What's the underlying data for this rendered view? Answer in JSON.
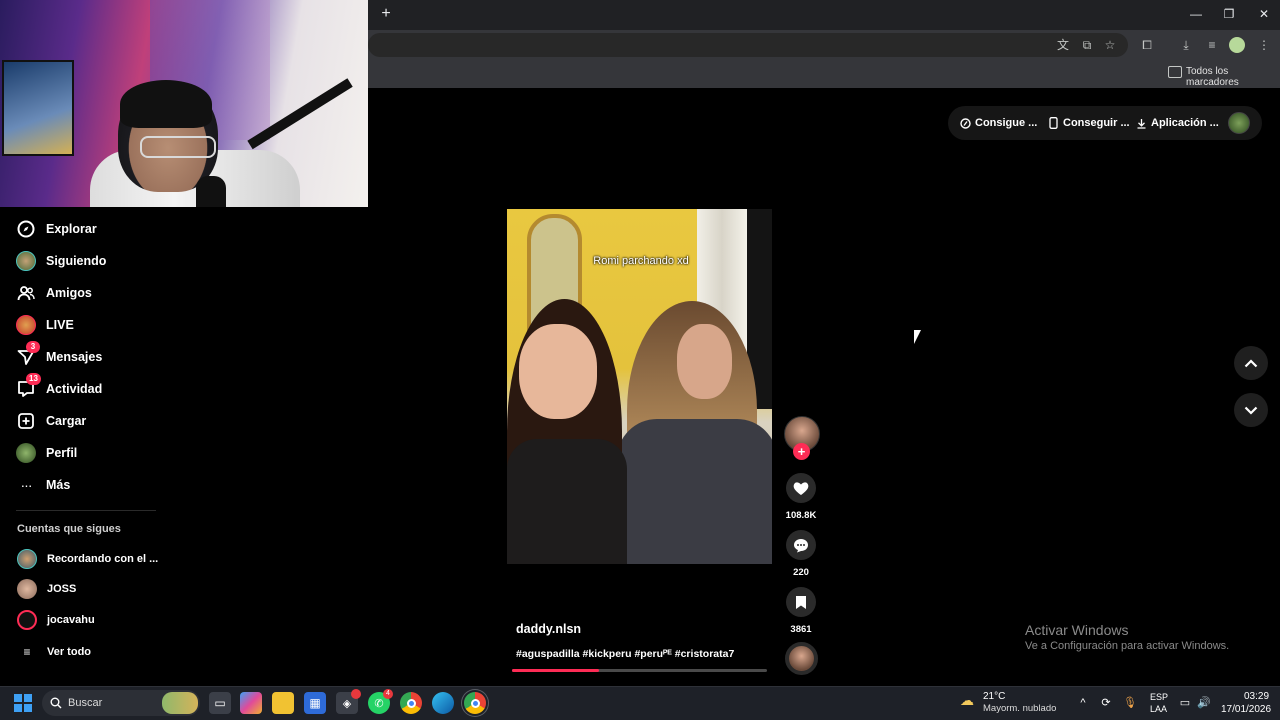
{
  "browser": {
    "new_tab_icon": "plus-icon",
    "window_controls": [
      "minimize",
      "restore",
      "close"
    ],
    "bookmarks_bar_label": "Todos los marcadores"
  },
  "header": {
    "buttons": [
      {
        "label": "Consigue ...",
        "icon": "coin-icon"
      },
      {
        "label": "Conseguir ...",
        "icon": "phone-icon"
      },
      {
        "label": "Aplicación ...",
        "icon": "download-icon"
      }
    ]
  },
  "sidebar": {
    "items": [
      {
        "label": "Explorar",
        "icon": "compass-icon"
      },
      {
        "label": "Siguiendo",
        "icon": "avatar"
      },
      {
        "label": "Amigos",
        "icon": "friends-icon"
      },
      {
        "label": "LIVE",
        "icon": "live-icon"
      },
      {
        "label": "Mensajes",
        "icon": "messages-icon",
        "badge": "3"
      },
      {
        "label": "Actividad",
        "icon": "activity-icon",
        "badge": "13"
      },
      {
        "label": "Cargar",
        "icon": "upload-icon"
      },
      {
        "label": "Perfil",
        "icon": "avatar"
      },
      {
        "label": "Más",
        "icon": "more-icon"
      }
    ],
    "following_title": "Cuentas que sigues",
    "accounts": [
      {
        "name": "Recordando con el ..."
      },
      {
        "name": "JOSS"
      },
      {
        "name": "jocavahu"
      }
    ],
    "see_all": "Ver todo"
  },
  "video": {
    "overlay_text": "Romi parchando xd",
    "username": "daddy.nlsn",
    "hashtags": "#aguspadilla #kickperu #peruᴾᴱ #cristorata7",
    "progress_pct": 34,
    "likes": "108.8K",
    "comments": "220",
    "saves": "3861"
  },
  "watermark": {
    "title": "Activar Windows",
    "subtitle": "Ve a Configuración para activar Windows."
  },
  "taskbar": {
    "search_label": "Buscar",
    "weather_temp": "21°C",
    "weather_desc": "Mayorm. nublado",
    "lang_1": "ESP",
    "lang_2": "LAA",
    "time": "03:29",
    "date": "17/01/2026",
    "whatsapp_badge": "4"
  },
  "colors": {
    "accent": "#fe2c55",
    "background": "#000000"
  }
}
